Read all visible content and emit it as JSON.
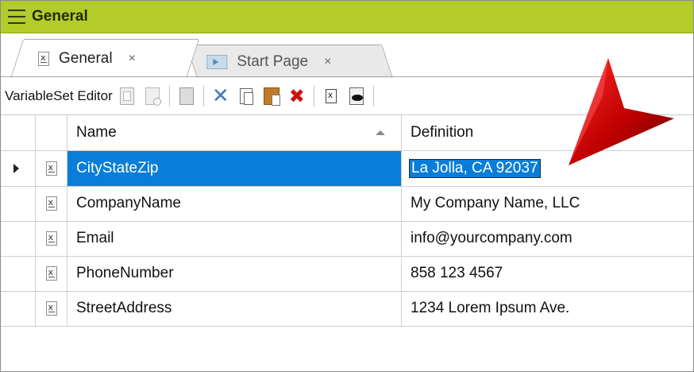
{
  "window": {
    "title": "General"
  },
  "tabs": [
    {
      "label": "General",
      "active": true,
      "close": "×"
    },
    {
      "label": "Start Page",
      "active": false,
      "close": "×"
    }
  ],
  "toolbar": {
    "label": "VariableSet Editor",
    "buttons": [
      {
        "name": "new-variable-icon"
      },
      {
        "name": "new-variable-alt-icon"
      },
      {
        "name": "page-icon"
      },
      {
        "name": "cut-icon"
      },
      {
        "name": "copy-icon"
      },
      {
        "name": "paste-icon"
      },
      {
        "name": "delete-icon"
      },
      {
        "name": "variable-icon"
      },
      {
        "name": "preview-icon"
      }
    ]
  },
  "grid": {
    "columns": [
      "Name",
      "Definition"
    ],
    "rows": [
      {
        "name": "CityStateZip",
        "definition": "La Jolla, CA 92037"
      },
      {
        "name": "CompanyName",
        "definition": "My Company Name, LLC"
      },
      {
        "name": "Email",
        "definition": "info@yourcompany.com"
      },
      {
        "name": "PhoneNumber",
        "definition": "858 123 4567"
      },
      {
        "name": "StreetAddress",
        "definition": "1234 Lorem Ipsum Ave."
      }
    ]
  },
  "colors": {
    "titlebar": "#b4cc2a",
    "selection": "#0a7dd8",
    "annotation": "#c00000"
  }
}
